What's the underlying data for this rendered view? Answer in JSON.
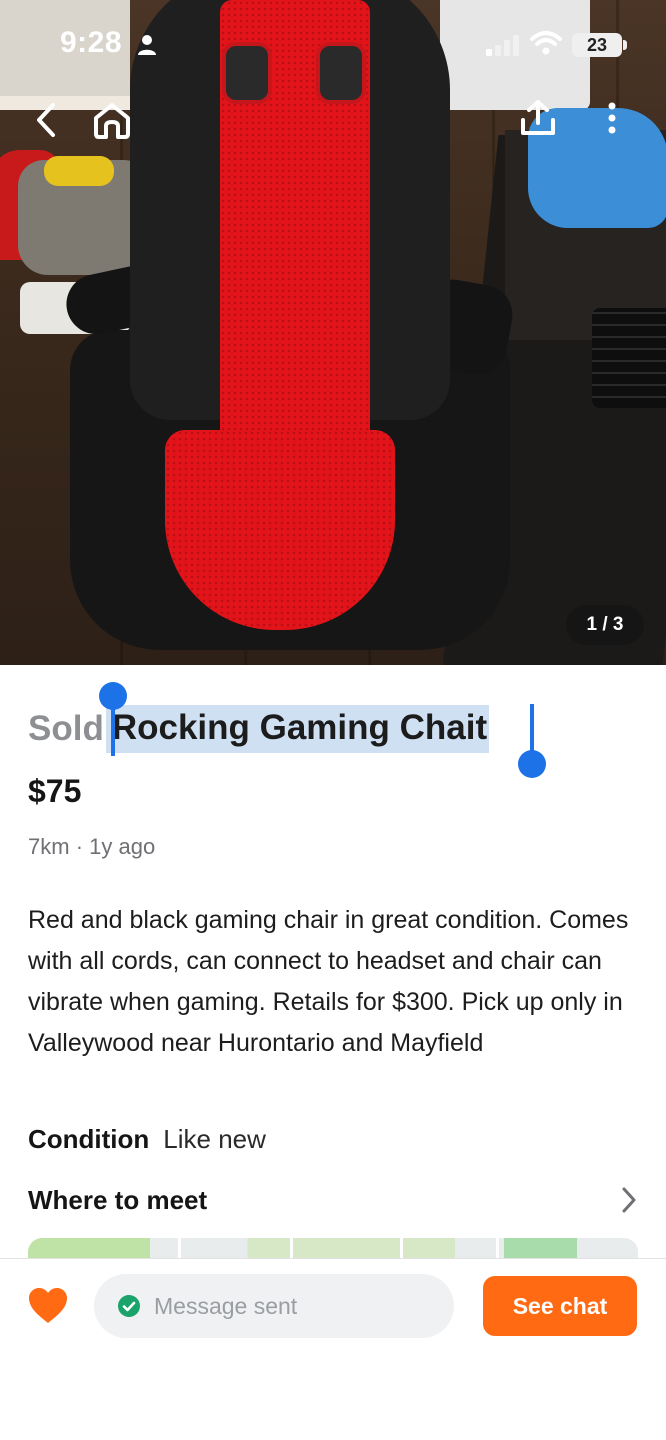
{
  "status_bar": {
    "time": "9:28",
    "battery": "23",
    "icons": [
      "person-icon",
      "signal-icon",
      "wifi-icon",
      "battery-icon"
    ]
  },
  "nav": {
    "icons": [
      "back-chevron-icon",
      "home-icon",
      "share-icon",
      "more-vertical-icon"
    ]
  },
  "gallery": {
    "counter": "1 / 3",
    "current": 1,
    "total": 3
  },
  "listing": {
    "status": "Sold",
    "title": "Rocking Gaming Chait",
    "selected_text": "Rocking Gaming Chait",
    "price": "$75",
    "distance": "7km",
    "separator": "·",
    "posted": "1y ago",
    "description": "Red and black gaming chair in great condition. Comes with all cords, can connect to headset and chair can vibrate when gaming. Retails for $300. Pick up only in Valleywood near Hurontario and Mayfield",
    "condition_label": "Condition",
    "condition_value": "Like new",
    "meet_label": "Where to meet"
  },
  "bottom_bar": {
    "message_status": "Message sent",
    "chat_button": "See chat",
    "favorited": true
  },
  "colors": {
    "accent_orange": "#ff6a13",
    "heart": "#ff6a13",
    "selection": "#cfe0f3",
    "selection_handle": "#1d72e8",
    "success_green": "#1aa36a",
    "sold_grey": "#8d8f93"
  }
}
